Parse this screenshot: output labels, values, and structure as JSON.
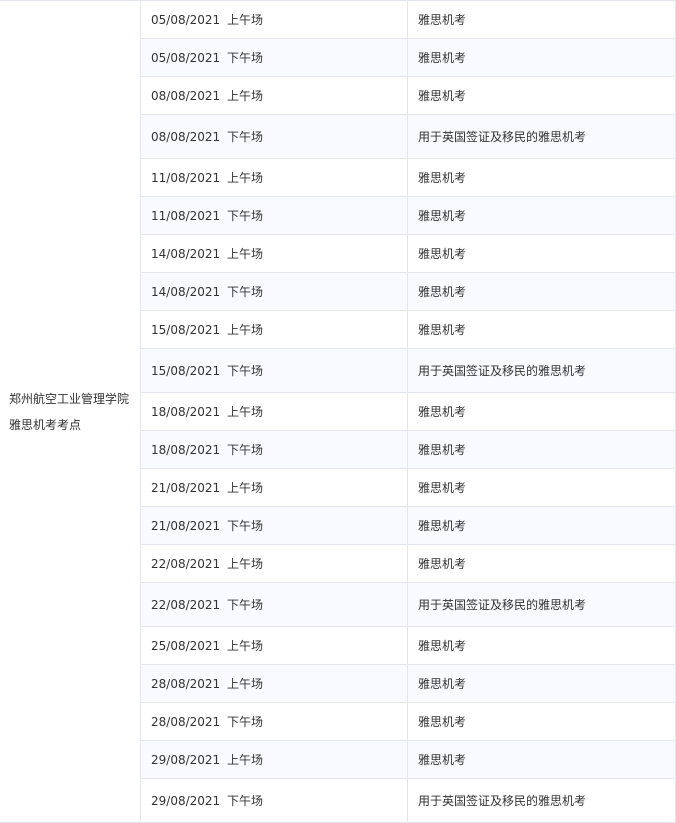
{
  "venue": "郑州航空工业管理学院雅思机考考点",
  "rows": [
    {
      "date": "05/08/2021",
      "session": "上午场",
      "test_type": "雅思机考"
    },
    {
      "date": "05/08/2021",
      "session": "下午场",
      "test_type": "雅思机考"
    },
    {
      "date": "08/08/2021",
      "session": "上午场",
      "test_type": "雅思机考"
    },
    {
      "date": "08/08/2021",
      "session": "下午场",
      "test_type": "用于英国签证及移民的雅思机考"
    },
    {
      "date": "11/08/2021",
      "session": "上午场",
      "test_type": "雅思机考"
    },
    {
      "date": "11/08/2021",
      "session": "下午场",
      "test_type": "雅思机考"
    },
    {
      "date": "14/08/2021",
      "session": "上午场",
      "test_type": "雅思机考"
    },
    {
      "date": "14/08/2021",
      "session": "下午场",
      "test_type": "雅思机考"
    },
    {
      "date": "15/08/2021",
      "session": "上午场",
      "test_type": "雅思机考"
    },
    {
      "date": "15/08/2021",
      "session": "下午场",
      "test_type": "用于英国签证及移民的雅思机考"
    },
    {
      "date": "18/08/2021",
      "session": "上午场",
      "test_type": "雅思机考"
    },
    {
      "date": "18/08/2021",
      "session": "下午场",
      "test_type": "雅思机考"
    },
    {
      "date": "21/08/2021",
      "session": "上午场",
      "test_type": "雅思机考"
    },
    {
      "date": "21/08/2021",
      "session": "下午场",
      "test_type": "雅思机考"
    },
    {
      "date": "22/08/2021",
      "session": "上午场",
      "test_type": "雅思机考"
    },
    {
      "date": "22/08/2021",
      "session": "下午场",
      "test_type": "用于英国签证及移民的雅思机考"
    },
    {
      "date": "25/08/2021",
      "session": "上午场",
      "test_type": "雅思机考"
    },
    {
      "date": "28/08/2021",
      "session": "上午场",
      "test_type": "雅思机考"
    },
    {
      "date": "28/08/2021",
      "session": "下午场",
      "test_type": "雅思机考"
    },
    {
      "date": "29/08/2021",
      "session": "上午场",
      "test_type": "雅思机考"
    },
    {
      "date": "29/08/2021",
      "session": "下午场",
      "test_type": "用于英国签证及移民的雅思机考"
    }
  ]
}
